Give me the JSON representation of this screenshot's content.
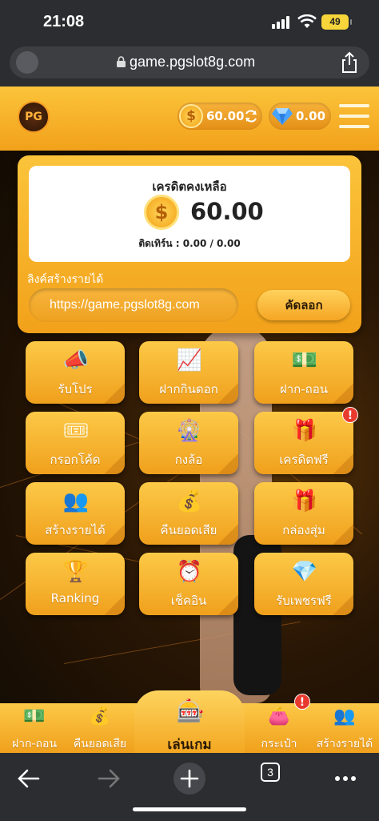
{
  "status": {
    "time": "21:08",
    "battery": "49"
  },
  "browser": {
    "url": "game.pgslot8g.com",
    "tabs_count": "3"
  },
  "header": {
    "logo_text": "PG",
    "coin_balance": "60.00",
    "gem_balance": "0.00"
  },
  "credit": {
    "title": "เครดิตคงเหลือ",
    "amount": "60.00",
    "turnover": "ติดเทิร์น : 0.00 / 0.00",
    "link_label": "ลิงค์สร้างรายได้",
    "link_value": "https://game.pgslot8g.com",
    "copy_label": "คัดลอก"
  },
  "menu": [
    {
      "label": "รับโปร",
      "icon": "megaphone-icon",
      "glyph": "📣"
    },
    {
      "label": "ฝากกินดอก",
      "icon": "coin-growth-icon",
      "glyph": "📈"
    },
    {
      "label": "ฝาก-ถอน",
      "icon": "cash-icon",
      "glyph": "💵"
    },
    {
      "label": "กรอกโค้ด",
      "icon": "coupon-icon",
      "glyph": "🎟"
    },
    {
      "label": "กงล้อ",
      "icon": "wheel-icon",
      "glyph": "🎡"
    },
    {
      "label": "เครดิตฟรี",
      "icon": "bonus-icon",
      "glyph": "🎁",
      "badge": "!"
    },
    {
      "label": "สร้างรายได้",
      "icon": "people-icon",
      "glyph": "👥"
    },
    {
      "label": "คืนยอดเสีย",
      "icon": "cashback-icon",
      "glyph": "💰"
    },
    {
      "label": "กล่องสุ่ม",
      "icon": "gift-box-icon",
      "glyph": "🎁"
    },
    {
      "label": "Ranking",
      "icon": "trophy-icon",
      "glyph": "🏆"
    },
    {
      "label": "เช็คอิน",
      "icon": "clock-calendar-icon",
      "glyph": "⏰"
    },
    {
      "label": "รับเพชรฟรี",
      "icon": "diamond-icon",
      "glyph": "💎"
    }
  ],
  "bottom_nav": {
    "deposit": "ฝาก-ถอน",
    "cashback": "คืนยอดเสีย",
    "play": "เล่นเกม",
    "wallet": "กระเป๋า",
    "wallet_badge": "!",
    "earn": "สร้างรายได้"
  },
  "colors": {
    "accent": "#f5a623",
    "badge": "#e83a2e"
  }
}
